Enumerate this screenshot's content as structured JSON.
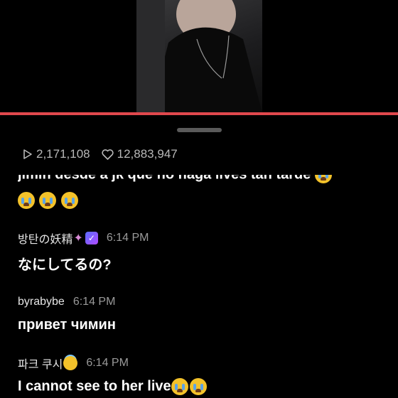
{
  "stats": {
    "views": "2,171,108",
    "likes": "12,883,947"
  },
  "comments": {
    "partial_text": "jimin desde a jk que no haga lives tan tarde",
    "items": [
      {
        "username": "방탄の妖精",
        "time": "6:14 PM",
        "text": "なにしてるの?"
      },
      {
        "username": "byrabybe",
        "time": "6:14 PM",
        "text": "привет чимин"
      },
      {
        "username": "파크 쿠시",
        "time": "6:14 PM",
        "text": "I cannot see to her live"
      }
    ]
  },
  "colors": {
    "progress": "#e0484d",
    "background": "#000000",
    "verified_badge": "#7b5cff"
  },
  "icons": [
    "play-icon",
    "heart-icon",
    "crying-emoji-icon",
    "fairy-emoji-icon",
    "verified-badge-icon",
    "halo-emoji-icon"
  ]
}
